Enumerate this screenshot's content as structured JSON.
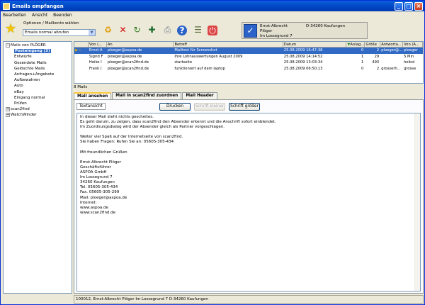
{
  "window": {
    "title": "Emails empfangen"
  },
  "menu": [
    "Bearbeiten",
    "Ansicht",
    "Beenden"
  ],
  "options": {
    "label": "Optionen / Mailkonto wählen",
    "selected": "Emails normal abrufen"
  },
  "contact": {
    "name": "Ernst-Albrecht",
    "name2": "Plöger",
    "street": "Im Lossegrund 7",
    "city": "D-34260 Kaufungen"
  },
  "tree": [
    {
      "label": "Mails von PLÖGER",
      "level": 0,
      "expander": "⊟"
    },
    {
      "label": "Posteingang (3)",
      "level": 1,
      "selected": true
    },
    {
      "label": "Entwürfe",
      "level": 1
    },
    {
      "label": "Gesendete Mails",
      "level": 1
    },
    {
      "label": "Gelöschte Mails",
      "level": 1
    },
    {
      "label": "Anfragen+Angebote",
      "level": 1
    },
    {
      "label": "Aufbewahren",
      "level": 1
    },
    {
      "label": "Auto",
      "level": 1
    },
    {
      "label": "eBay",
      "level": 1
    },
    {
      "label": "Eingang normal",
      "level": 1
    },
    {
      "label": "Prüfen",
      "level": 1
    },
    {
      "label": "scan2find",
      "level": 0,
      "expander": "⊞"
    },
    {
      "label": "WatchWinder",
      "level": 0,
      "expander": "⊞"
    }
  ],
  "grid": {
    "columns": [
      "",
      "Von (...",
      "An",
      "Betreff",
      "Datum",
      "Anlag...",
      "Größe",
      "Antworta...",
      "Von (A..."
    ],
    "rows": [
      {
        "flag": "▶☆",
        "from": "Ernst-A",
        "to": "ploeger@aspoa.de",
        "subject": "Mailtest für Screenshot",
        "date": "25.08.2009 16:47:38",
        "att": "0",
        "size": "2",
        "reply": "ploeger@...",
        "from2": "ploeger",
        "selected": true
      },
      {
        "flag": "",
        "from": "Sigrid F",
        "to": "ploeger@aspoa.de",
        "subject": "Ihre Lohnauswertungen August 2009",
        "date": "25.08.2009 14:14:52",
        "att": "1",
        "size": "29",
        "reply": "",
        "from2": "5 Min"
      },
      {
        "flag": "",
        "from": "Heiko I",
        "to": "ploeger@scan2find.de",
        "subject": "startseite",
        "date": "25.08.2009 13:03:34",
        "att": "1",
        "size": "493",
        "reply": "",
        "from2": "heikol"
      },
      {
        "flag": "",
        "from": "Frank (",
        "to": "ploeger@scan2find.de",
        "subject": "funktioniert auf dem laptop",
        "date": "25.08.2009 06:50:13",
        "att": "0",
        "size": "2",
        "reply": "grosserh...",
        "from2": "grosse"
      }
    ]
  },
  "mail_count": "8 Mails",
  "tabs": [
    "Mail ansehen",
    "Mail in scan2find zuordnen",
    "Mail Header"
  ],
  "panel": {
    "view_label": "Textansicht",
    "print": "Drucken",
    "smaller": "Schrift kleiner",
    "bigger": "Schrift größer"
  },
  "message_lines": [
    "In dieser Mail steht nichts gescheites.",
    "Es geht darum, zu zeigen, dass scan2find den Absender erkennt und die Anschrift sofort einblendet.",
    "Im Zuordnungsdialog wird der Absender gleich als Partner vorgeschlagen.",
    "",
    "Weiter viel Spaß auf der Internetseite von scan2find.",
    "Sie haben Fragen: Rufen Sie an: 05605-305-434",
    "",
    "Mit freundlichen Grüßen",
    "",
    "Ernst-Albrecht Plöger",
    "Geschäftsführer",
    "ASPOA GmbH",
    "Im Lossegrund 7",
    "34260 Kaufungen",
    "Tel. 05605-305-434",
    "Fax. 05605-305-299",
    "Mail: ploeger@aspoa.de",
    "Internet:",
    "www.aspoa.de",
    "www.scan2find.de"
  ],
  "status": "100012, Ernst-Albrecht Plöger Im Lossegrund 7 D-34260 Kaufungen",
  "colors": {
    "selection": "#316ac5",
    "titlebar": "#0045c2"
  }
}
